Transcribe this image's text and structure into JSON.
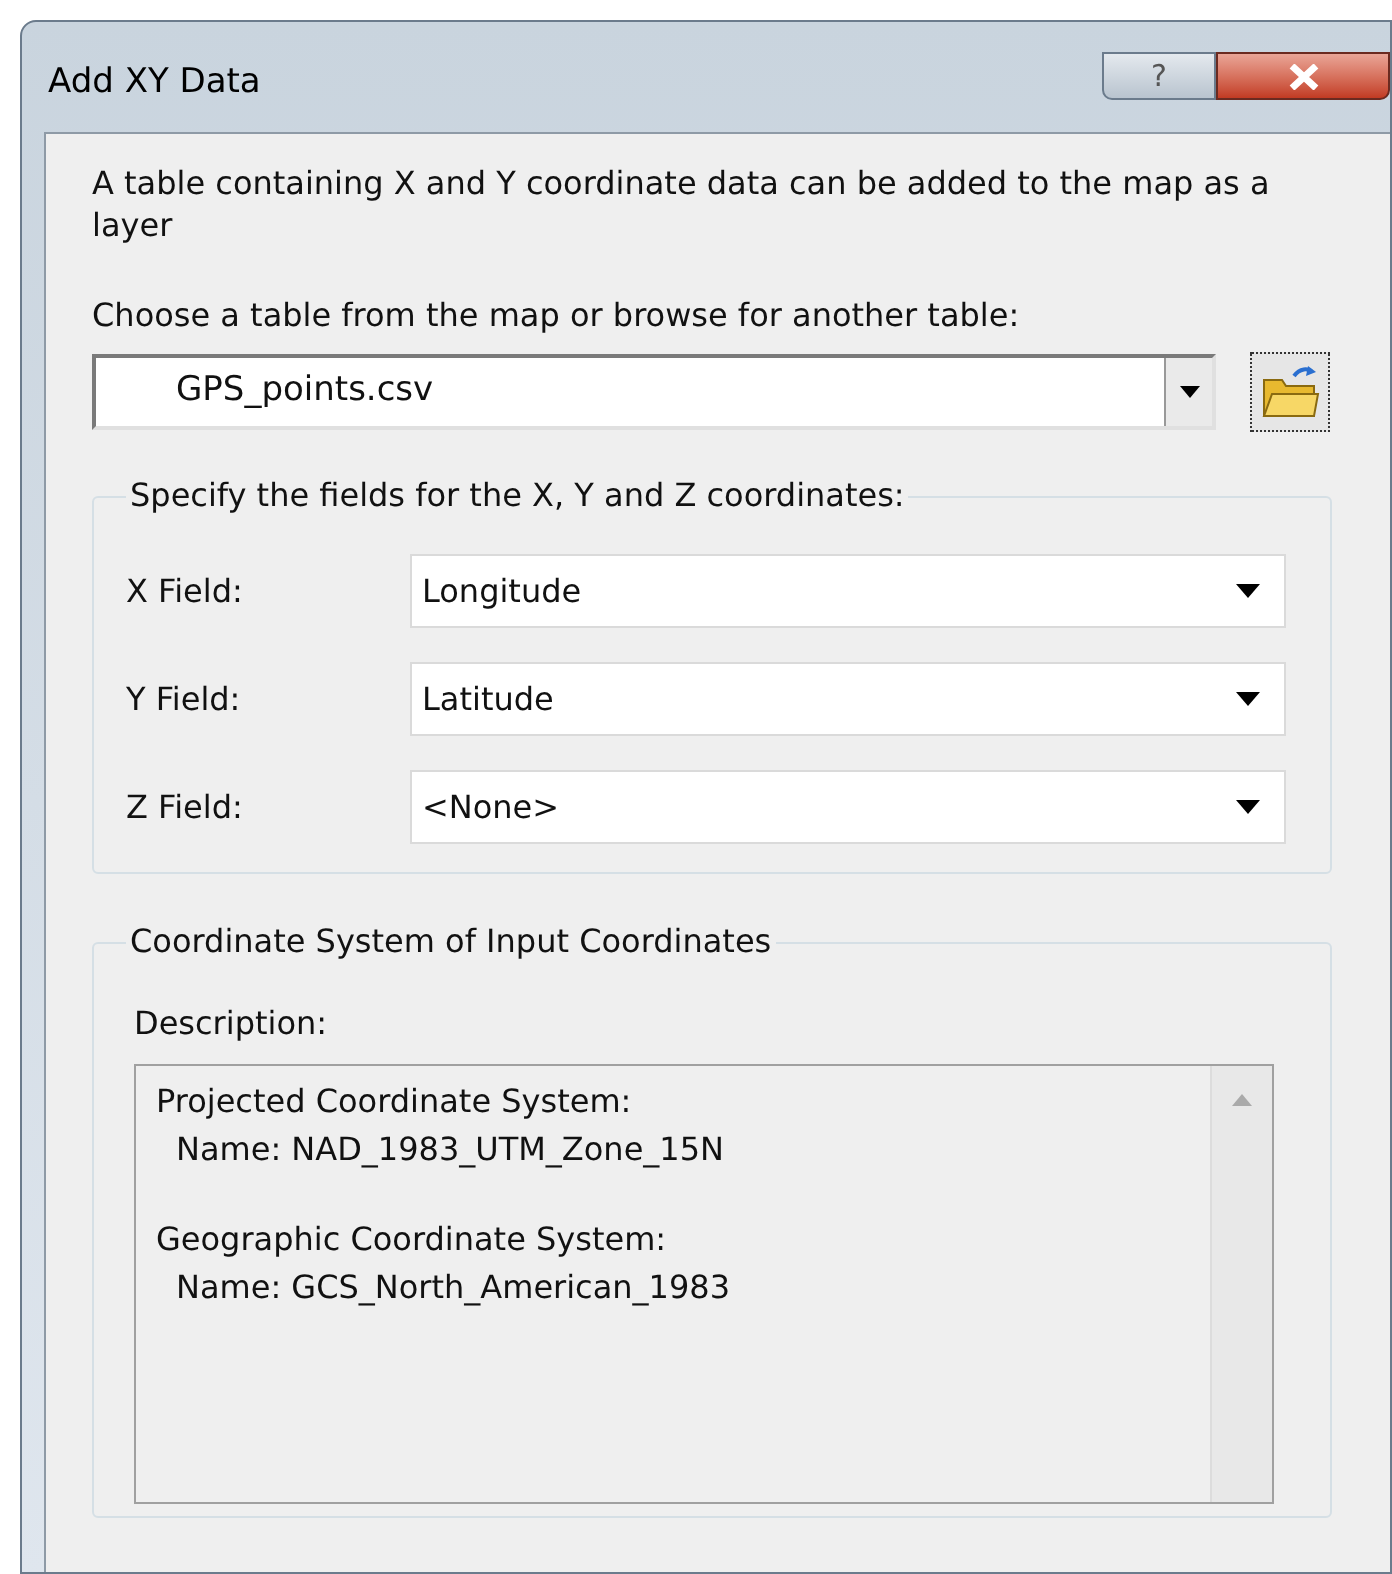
{
  "window": {
    "title": "Add XY Data",
    "buttons": [
      {
        "kind": "help",
        "label": "?"
      },
      {
        "kind": "close"
      }
    ]
  },
  "intro": "A table containing X and Y coordinate data can be added to the map as a layer",
  "table_prompt": "Choose a table from the map or browse for another table:",
  "table_combo": {
    "value": "GPS_points.csv"
  },
  "fields_group": {
    "legend": "Specify the fields for the X, Y and Z coordinates:",
    "fields": [
      {
        "label": "X Field:",
        "value": "Longitude"
      },
      {
        "label": "Y Field:",
        "value": "Latitude"
      },
      {
        "label": "Z Field:",
        "value": "<None>"
      }
    ]
  },
  "coordinate_group": {
    "legend": "Coordinate System of Input Coordinates",
    "description_label": "Description:",
    "description": [
      {
        "heading": "Projected Coordinate System:",
        "name": "Name: NAD_1983_UTM_Zone_15N"
      },
      {
        "heading": "Geographic Coordinate System:",
        "name": "Name: GCS_North_American_1983"
      }
    ]
  }
}
